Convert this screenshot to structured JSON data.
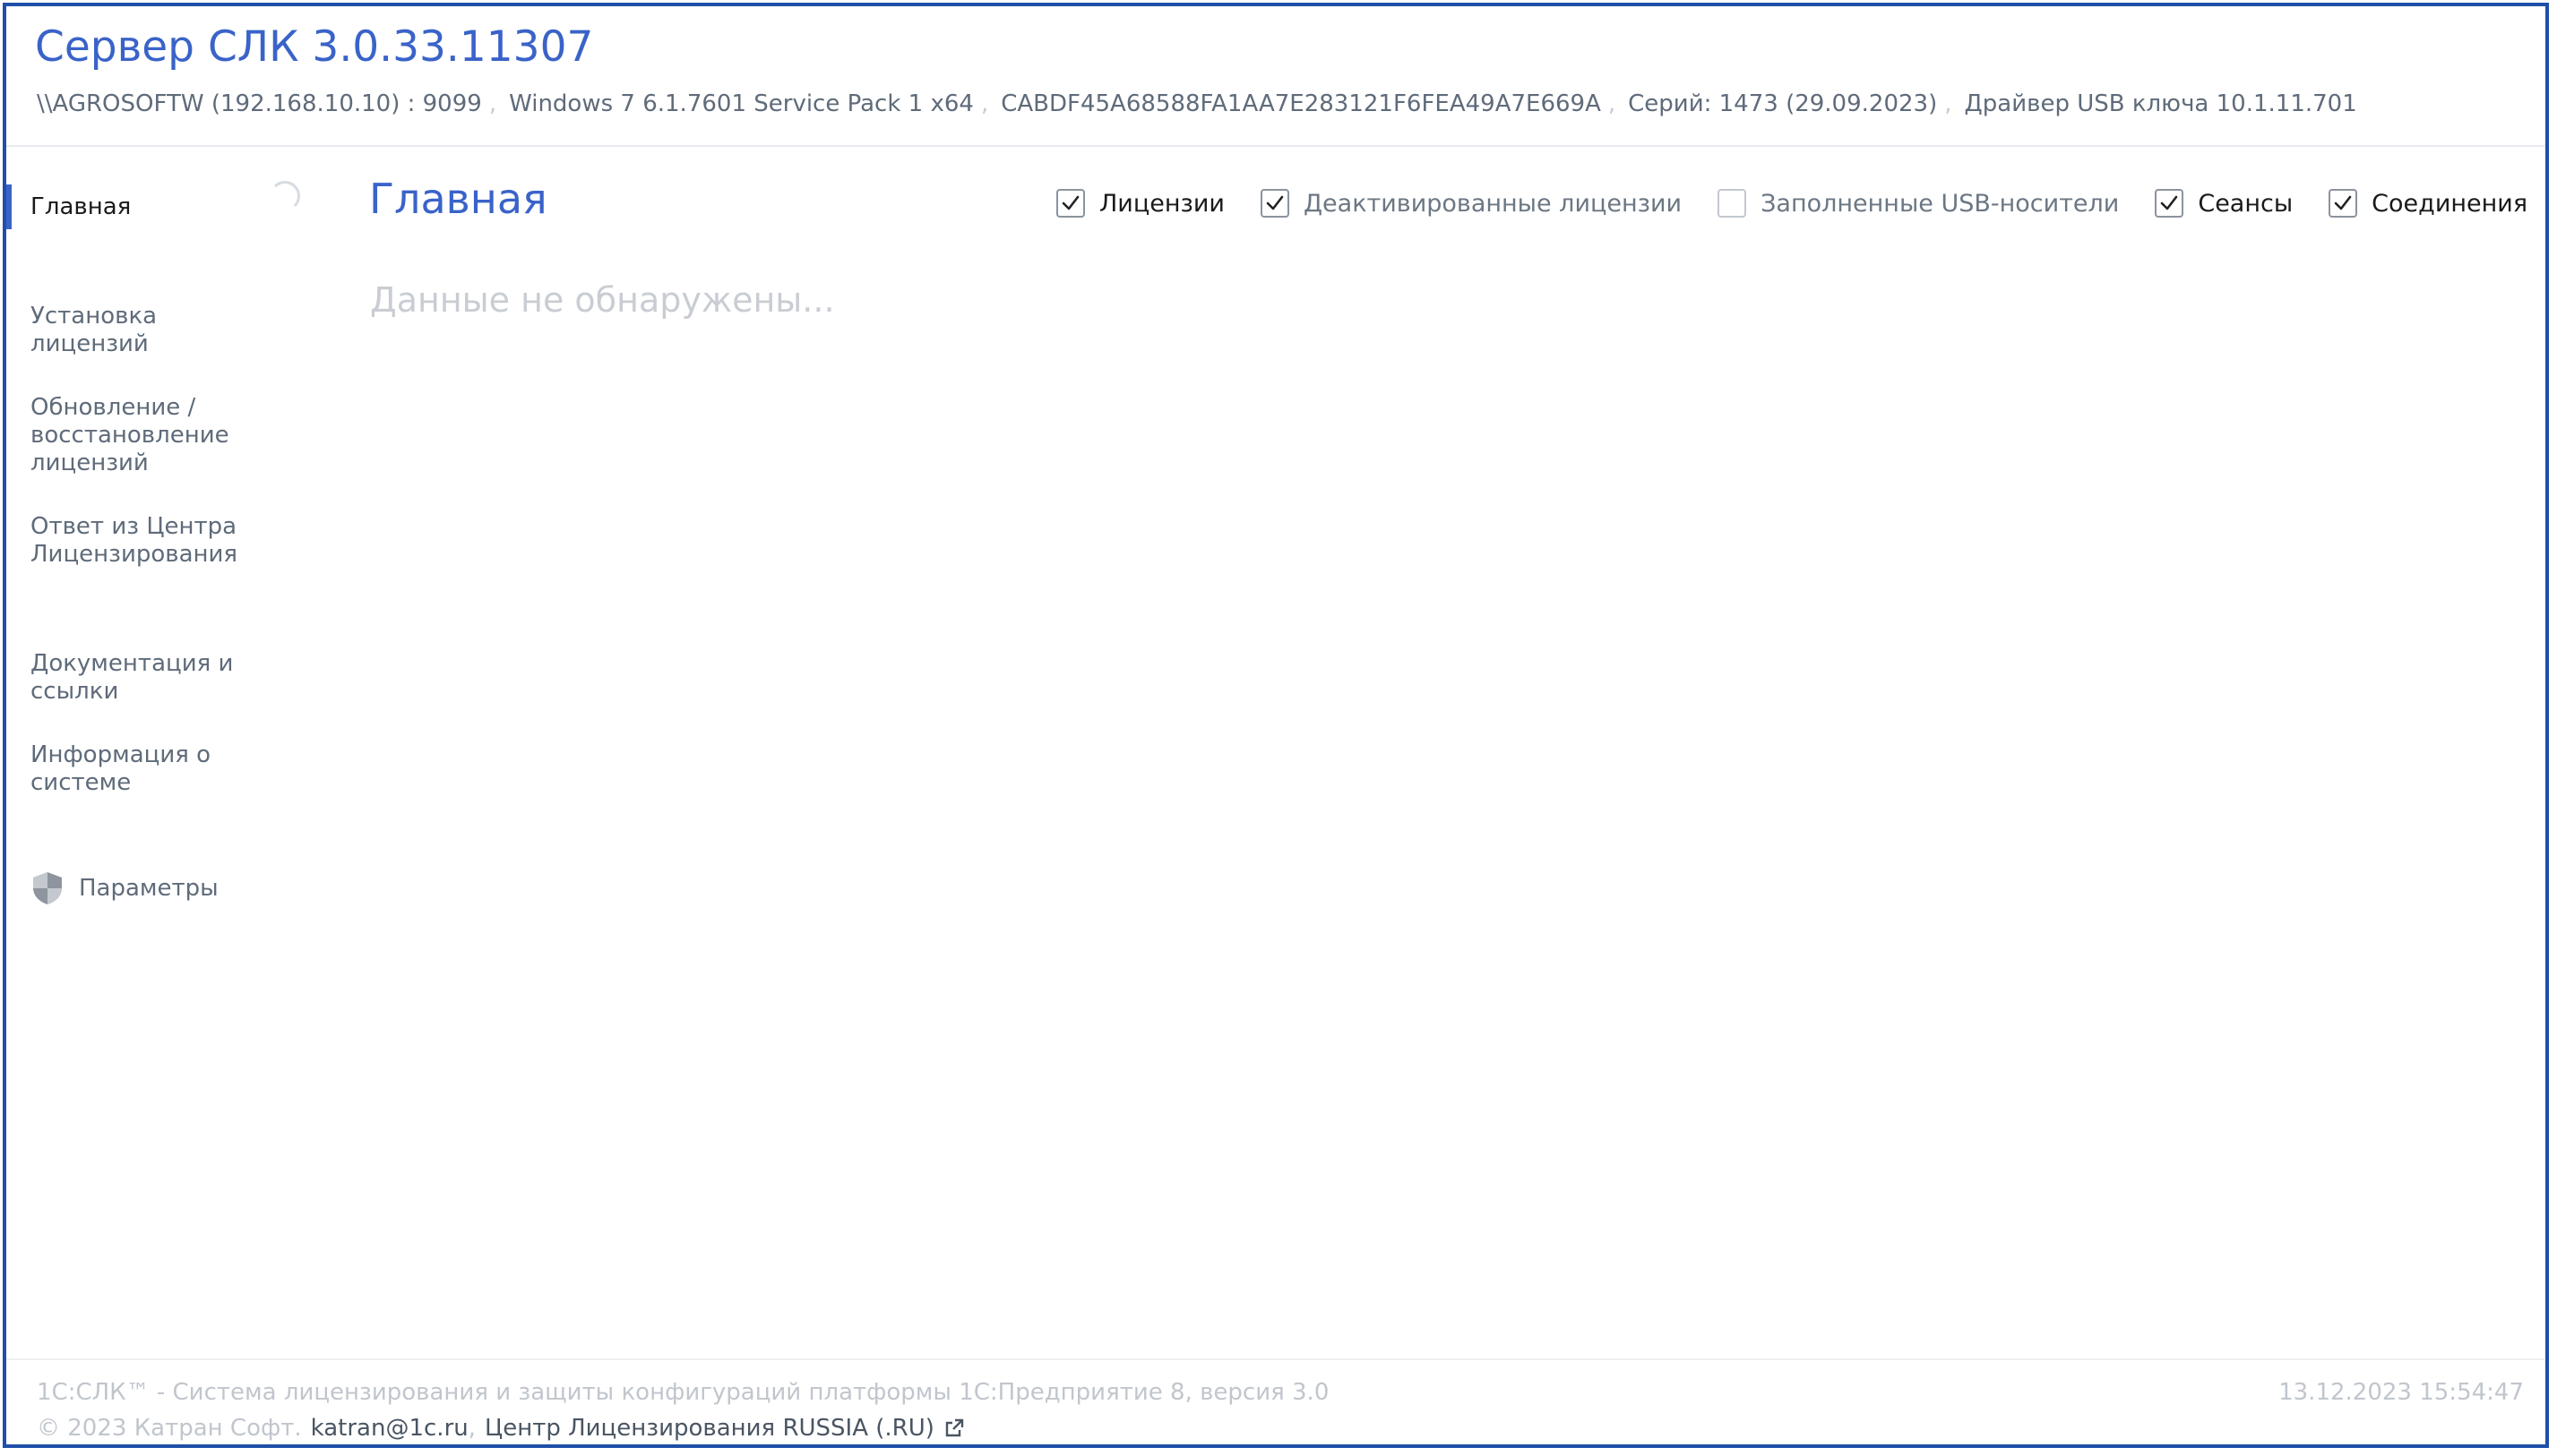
{
  "header": {
    "title": "Сервер СЛК 3.0.33.11307",
    "info": {
      "host": "\\\\AGROSOFTW (192.168.10.10) : 9099",
      "os": "Windows 7 6.1.7601 Service Pack 1 x64",
      "id": "CABDF45A68588FA1AA7E283121F6FEA49A7E669A",
      "series": "Серий: 1473 (29.09.2023)",
      "driver": "Драйвер USB ключа 10.1.11.701",
      "separator": ","
    }
  },
  "sidebar": {
    "items": [
      {
        "label": "Главная"
      },
      {
        "label": "Установка лицензий"
      },
      {
        "label": "Обновление / восстановление лицензий"
      },
      {
        "label": "Ответ из Центра Лицензирования"
      },
      {
        "label": "Документация и ссылки"
      },
      {
        "label": "Информация о системе"
      }
    ],
    "params": {
      "label": "Параметры",
      "icon": "shield-icon"
    }
  },
  "main": {
    "title": "Главная",
    "filters": [
      {
        "label": "Лицензии",
        "checked": true
      },
      {
        "label": "Деактивированные лицензии",
        "checked": true
      },
      {
        "label": "Заполненные USB-носители",
        "checked": false
      },
      {
        "label": "Сеансы",
        "checked": true
      },
      {
        "label": "Соединения",
        "checked": true
      }
    ],
    "empty_text": "Данные не обнаружены..."
  },
  "footer": {
    "line1": "1С:СЛК™ - Система лицензирования и защиты конфигураций платформы 1С:Предприятие 8, версия 3.0",
    "timestamp": "13.12.2023 15:54:47",
    "copyright": "© 2023 Катран Софт.",
    "email": "katran@1c.ru",
    "comma": ",",
    "center_link": "Центр Лицензирования RUSSIA (.RU)"
  },
  "colors": {
    "accent": "#3a63c9",
    "frame": "#1f4fa8"
  }
}
